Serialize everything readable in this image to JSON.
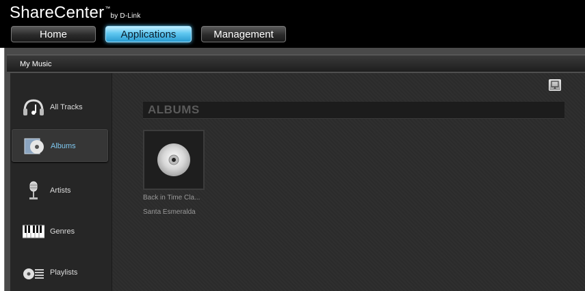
{
  "header": {
    "brand": "ShareCenter",
    "brand_tm": "™",
    "brand_by": "by D-Link",
    "nav": [
      {
        "label": "Home"
      },
      {
        "label": "Applications"
      },
      {
        "label": "Management"
      }
    ],
    "active_nav": "Applications"
  },
  "window": {
    "title": "My Music"
  },
  "sidebar": {
    "items": [
      {
        "label": "All Tracks",
        "icon": "headphones-icon"
      },
      {
        "label": "Albums",
        "icon": "album-cd-icon"
      },
      {
        "label": "Artists",
        "icon": "microphone-icon"
      },
      {
        "label": "Genres",
        "icon": "piano-keys-icon"
      },
      {
        "label": "Playlists",
        "icon": "playlist-icon"
      }
    ],
    "selected": "Albums"
  },
  "main": {
    "section_title": "ALBUMS",
    "albums": [
      {
        "title": "Back in Time Cla...",
        "artist": "Santa Esmeralda"
      }
    ]
  },
  "colors": {
    "accent": "#5fc7f0",
    "selected_text": "#7fc8f0",
    "background": "#2c2c2c"
  }
}
